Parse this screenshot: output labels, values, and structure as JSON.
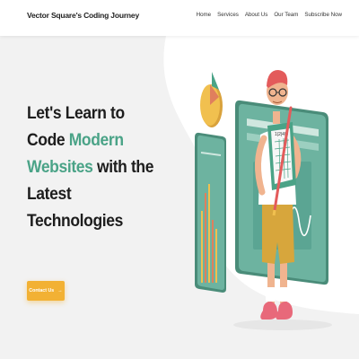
{
  "header": {
    "brand": "Vector Square's Coding Journey",
    "nav": [
      "Home",
      "Services",
      "About Us",
      "Our Team",
      "Subscribe Now"
    ]
  },
  "hero": {
    "line1": "Let's Learn to",
    "line2_start": "Code ",
    "line2_accent": "Modern",
    "line3_accent": "Websites",
    "line3_end": " with the",
    "line4": "Latest",
    "line5": "Technologies",
    "cta_label": "Contact Us",
    "cta_arrow": "→"
  },
  "illustration": {
    "tablet_text": "1|2|4|5"
  },
  "colors": {
    "accent": "#4aa387",
    "cta": "#f2b134",
    "panel": "#5fa896",
    "background": "#f2f2f2"
  },
  "icons": [
    "pie-chart-icon",
    "bar-chart-icon",
    "wave-chart-icon",
    "arrow-right-icon"
  ]
}
